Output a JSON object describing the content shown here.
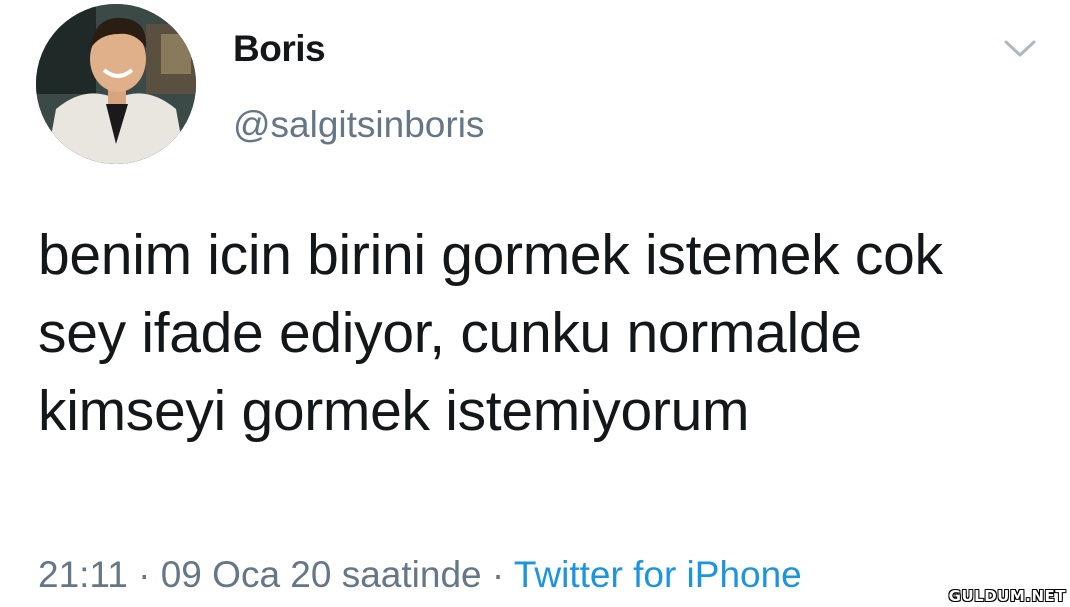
{
  "tweet": {
    "author": {
      "display_name": "Boris",
      "handle": "@salgitsinboris"
    },
    "text": "benim icin birini gormek istemek cok sey ifade ediyor, cunku normalde kimseyi gormek istemiyorum",
    "timestamp": "21:11 · 09 Oca 20 saatinde",
    "separator": " · ",
    "source": "Twitter for iPhone"
  },
  "icons": {
    "menu": "chevron-down-icon",
    "avatar": "avatar"
  },
  "colors": {
    "name": "#14171a",
    "secondary": "#657786",
    "link": "#1b95e0"
  },
  "watermark": "GULDUM.NET"
}
